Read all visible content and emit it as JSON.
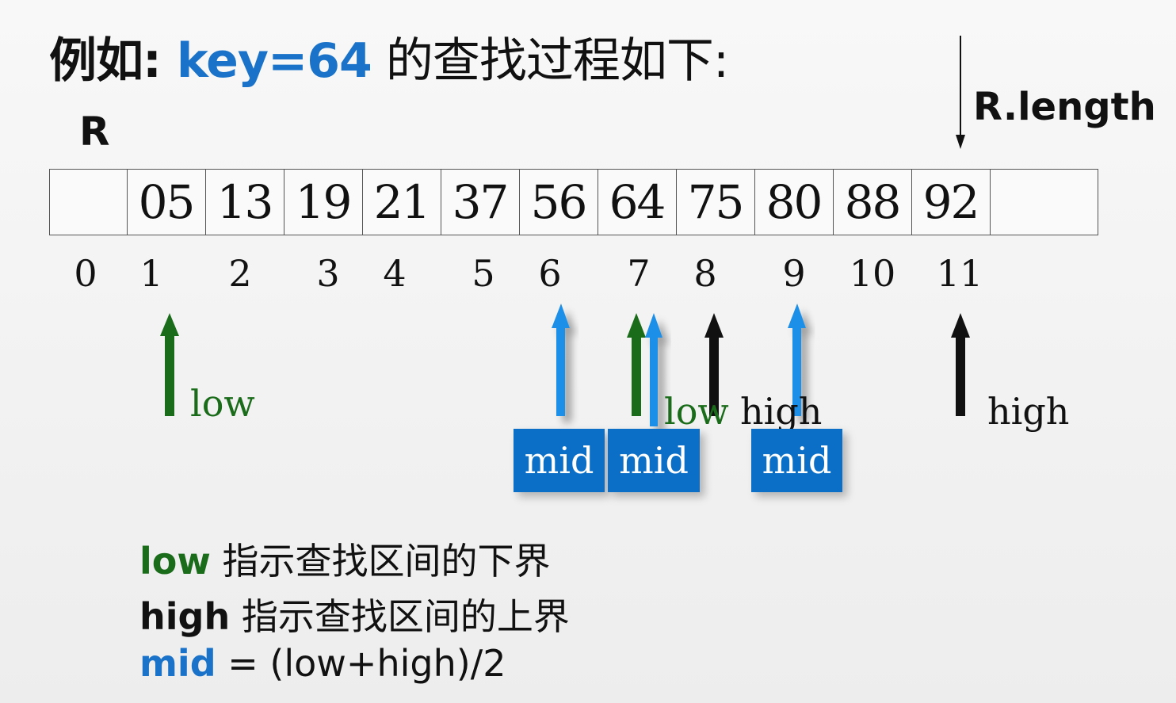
{
  "title": {
    "prefix": "例如: ",
    "key": "key=64",
    "suffix": " 的查找过程如下:"
  },
  "array_name": "R",
  "length_label": "R.length",
  "cells": [
    "",
    "05",
    "13",
    "19",
    "21",
    "37",
    "56",
    "64",
    "75",
    "80",
    "88",
    "92",
    ""
  ],
  "indices": [
    "0",
    "1",
    "2",
    "3",
    "4",
    "5",
    "6",
    "7",
    "8",
    "9",
    "10",
    "11"
  ],
  "pointers": {
    "low_initial": "low",
    "low_final": "low",
    "high_final": "high",
    "high_initial": "high",
    "mid_1": "mid",
    "mid_2": "mid",
    "mid_3": "mid"
  },
  "colors": {
    "low": "#1a6b1a",
    "mid": "#1a73c8",
    "high": "#111111",
    "mid_box": "#0c6fc7"
  },
  "legend": {
    "low_term": "low",
    "low_desc": " 指示查找区间的下界",
    "high_term": "high",
    "high_desc": " 指示查找区间的上界",
    "mid_term": "mid",
    "mid_desc": " = (low+high)/2"
  }
}
